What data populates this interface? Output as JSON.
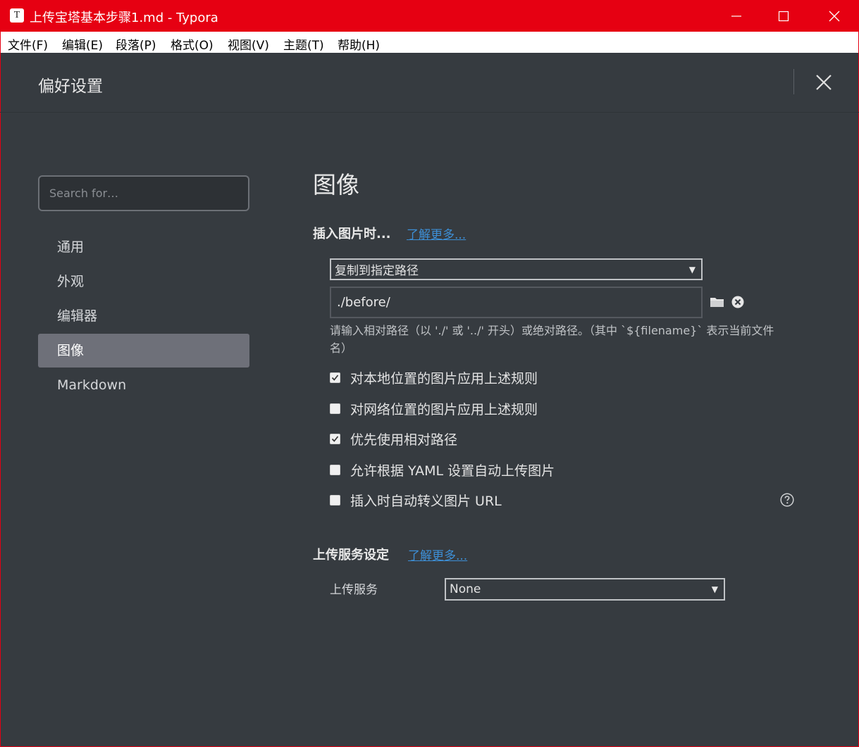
{
  "window": {
    "app_icon": "T",
    "title": "上传宝塔基本步骤1.md - Typora",
    "accent": "#e60012"
  },
  "menubar": {
    "items": [
      "文件(F)",
      "编辑(E)",
      "段落(P)",
      "格式(O)",
      "视图(V)",
      "主题(T)",
      "帮助(H)"
    ]
  },
  "preferences": {
    "title": "偏好设置"
  },
  "sidebar": {
    "search_placeholder": "Search for…",
    "items": [
      {
        "label": "通用",
        "active": false
      },
      {
        "label": "外观",
        "active": false
      },
      {
        "label": "编辑器",
        "active": false
      },
      {
        "label": "图像",
        "active": true
      },
      {
        "label": "Markdown",
        "active": false
      }
    ]
  },
  "image_section": {
    "title": "图像",
    "insert_heading": "插入图片时...",
    "insert_link": "了解更多...",
    "insert_action": "复制到指定路径",
    "path_value": "./before/",
    "path_hint": "请输入相对路径（以 './' 或 '../' 开头）或绝对路径。（其中 `${filename}` 表示当前文件名）",
    "options": [
      {
        "label": "对本地位置的图片应用上述规则",
        "checked": true
      },
      {
        "label": "对网络位置的图片应用上述规则",
        "checked": false
      },
      {
        "label": "优先使用相对路径",
        "checked": true
      },
      {
        "label": "允许根据 YAML 设置自动上传图片",
        "checked": false
      },
      {
        "label": "插入时自动转义图片 URL",
        "checked": false
      }
    ],
    "upload_heading": "上传服务设定",
    "upload_link": "了解更多...",
    "upload_service_label": "上传服务",
    "upload_service_value": "None"
  }
}
